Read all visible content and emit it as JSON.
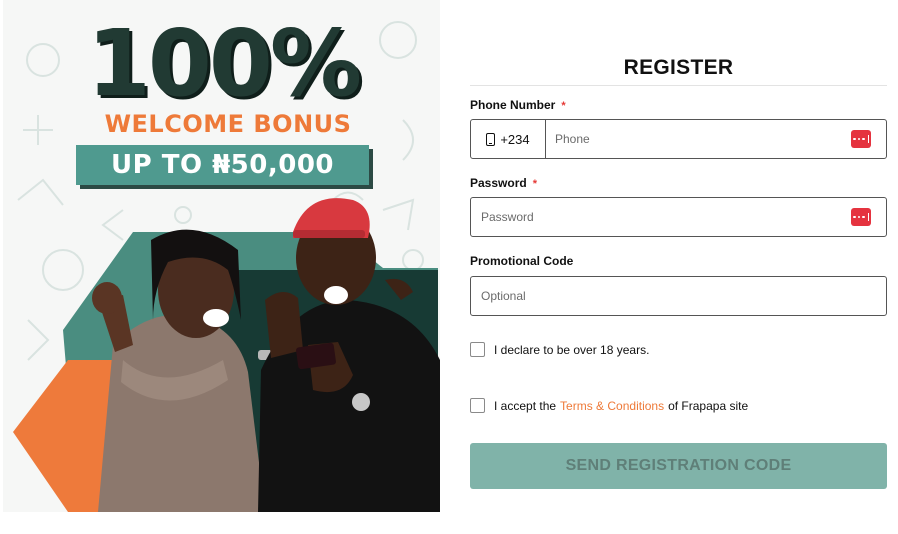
{
  "banner": {
    "percent": "100%",
    "bonus_label": "WELCOME BONUS",
    "amount_label": "UP TO ₦50,000",
    "colors": {
      "dark_green": "#213a33",
      "orange": "#ee7a39",
      "teal": "#4f9a8f"
    }
  },
  "form": {
    "title": "REGISTER",
    "phone": {
      "label": "Phone Number",
      "required_mark": "*",
      "country_code": "+234",
      "placeholder": "Phone",
      "prefix_icon": "phone-icon",
      "trailing_icon": "password-manager-icon"
    },
    "password": {
      "label": "Password",
      "required_mark": "*",
      "placeholder": "Password",
      "trailing_icon": "password-manager-icon"
    },
    "promo": {
      "label": "Promotional Code",
      "placeholder": "Optional"
    },
    "age_checkbox": {
      "label": "I declare to be over 18 years.",
      "checked": false
    },
    "terms_checkbox": {
      "prefix": "I accept the",
      "link": "Terms & Conditions",
      "suffix": "of Frapapa site",
      "checked": false
    },
    "submit_label": "SEND REGISTRATION CODE",
    "colors": {
      "accent_link": "#ee7a39",
      "button_bg": "#80b3a9",
      "required": "#e53935",
      "key_icon": "#e5333f"
    }
  }
}
